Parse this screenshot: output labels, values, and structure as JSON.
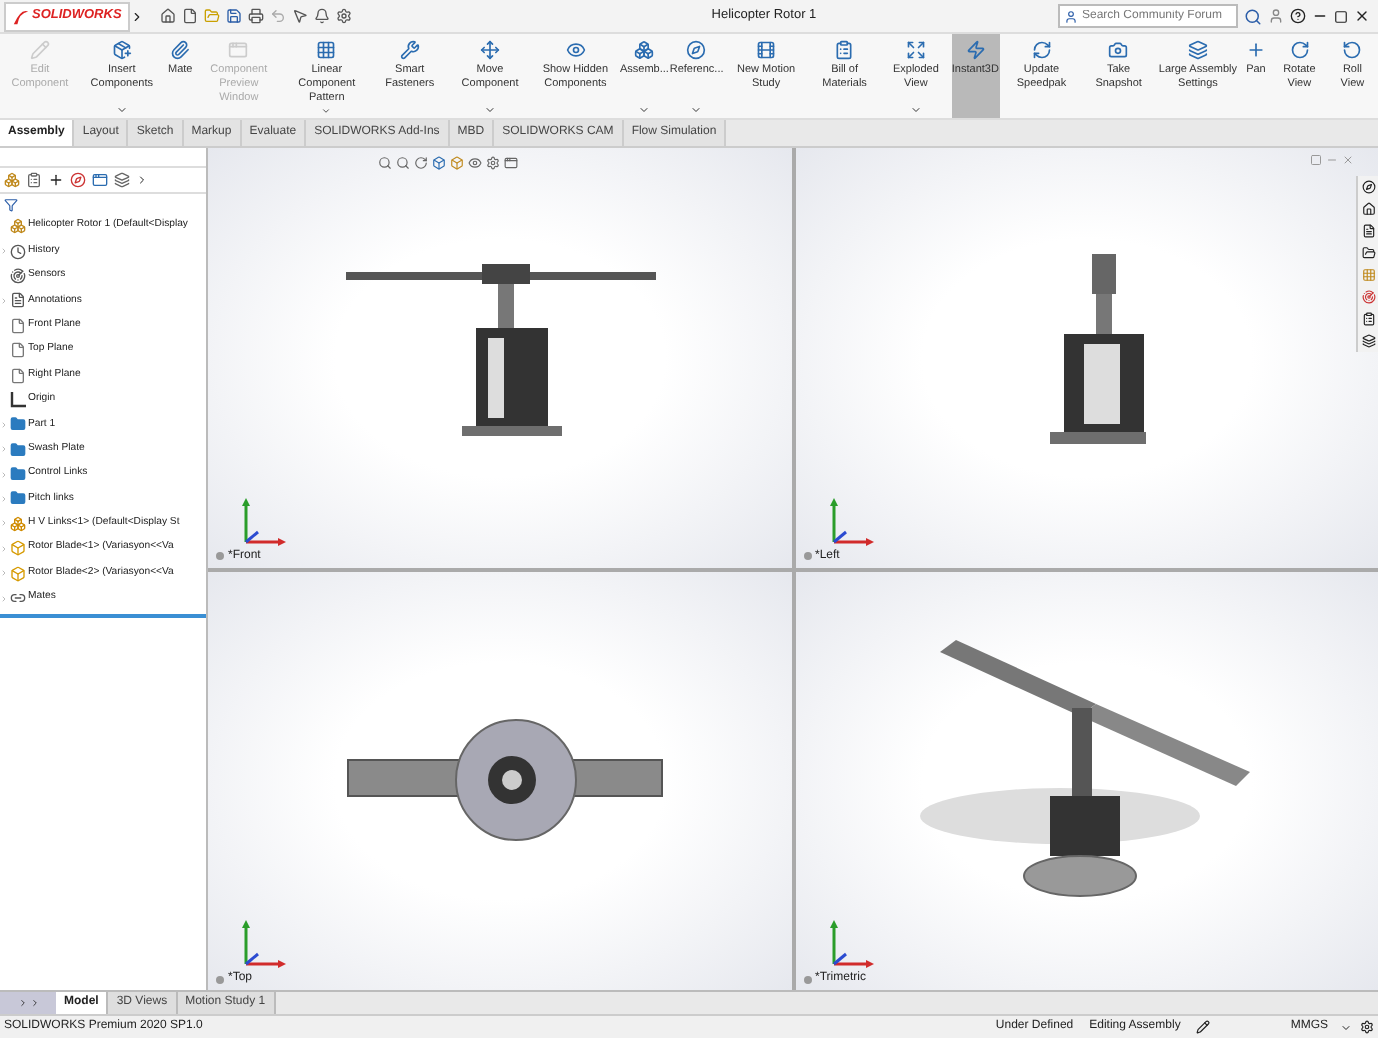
{
  "title_bar": {
    "brand": "SOLIDWORKS",
    "title": "Helicopter Rotor 1",
    "search": {
      "placeholder": "Search Community Forum"
    }
  },
  "ribbon": [
    {
      "label": "Edit Component",
      "disabled": true,
      "selected": false,
      "caret": false
    },
    {
      "label": "Insert Components",
      "disabled": false,
      "selected": false,
      "caret": true
    },
    {
      "label": "Mate",
      "disabled": false,
      "selected": false,
      "caret": false
    },
    {
      "label": "Component Preview Window",
      "disabled": true,
      "selected": false,
      "caret": false
    },
    {
      "label": "Linear Component Pattern",
      "disabled": false,
      "selected": false,
      "caret": true
    },
    {
      "label": "Smart Fasteners",
      "disabled": false,
      "selected": false,
      "caret": false
    },
    {
      "label": "Move Component",
      "disabled": false,
      "selected": false,
      "caret": true
    },
    {
      "label": "Show Hidden Components",
      "disabled": false,
      "selected": false,
      "caret": false
    },
    {
      "label": "Assemb...",
      "disabled": false,
      "selected": false,
      "caret": true
    },
    {
      "label": "Referenc...",
      "disabled": false,
      "selected": false,
      "caret": true
    },
    {
      "label": "New Motion Study",
      "disabled": false,
      "selected": false,
      "caret": false
    },
    {
      "label": "Bill of Materials",
      "disabled": false,
      "selected": false,
      "caret": false
    },
    {
      "label": "Exploded View",
      "disabled": false,
      "selected": false,
      "caret": true
    },
    {
      "label": "Instant3D",
      "disabled": false,
      "selected": true,
      "caret": false
    },
    {
      "label": "Update Speedpak",
      "disabled": false,
      "selected": false,
      "caret": false
    },
    {
      "label": "Take Snapshot",
      "disabled": false,
      "selected": false,
      "caret": false
    },
    {
      "label": "Large Assembly Settings",
      "disabled": false,
      "selected": false,
      "caret": false
    },
    {
      "label": "Pan",
      "disabled": false,
      "selected": false,
      "caret": false
    },
    {
      "label": "Rotate View",
      "disabled": false,
      "selected": false,
      "caret": false
    },
    {
      "label": "Roll View",
      "disabled": false,
      "selected": false,
      "caret": false
    }
  ],
  "tabs": [
    {
      "label": "Assembly",
      "selected": true
    },
    {
      "label": "Layout",
      "selected": false
    },
    {
      "label": "Sketch",
      "selected": false
    },
    {
      "label": "Markup",
      "selected": false
    },
    {
      "label": "Evaluate",
      "selected": false
    },
    {
      "label": "SOLIDWORKS Add-Ins",
      "selected": false
    },
    {
      "label": "MBD",
      "selected": false
    },
    {
      "label": "SOLIDWORKS CAM",
      "selected": false
    },
    {
      "label": "Flow Simulation",
      "selected": false
    }
  ],
  "feature_tree": [
    {
      "label": "Helicopter Rotor 1 (Default<Display",
      "kind": "assembly",
      "expandable": false
    },
    {
      "label": "History",
      "kind": "history",
      "expandable": true
    },
    {
      "label": "Sensors",
      "kind": "sensor",
      "expandable": false
    },
    {
      "label": "Annotations",
      "kind": "annotation",
      "expandable": true
    },
    {
      "label": "Front Plane",
      "kind": "plane",
      "expandable": false
    },
    {
      "label": "Top Plane",
      "kind": "plane",
      "expandable": false
    },
    {
      "label": "Right Plane",
      "kind": "plane",
      "expandable": false
    },
    {
      "label": "Origin",
      "kind": "origin",
      "expandable": false
    },
    {
      "label": "Part 1",
      "kind": "folder",
      "expandable": true
    },
    {
      "label": "Swash Plate",
      "kind": "folder",
      "expandable": true
    },
    {
      "label": "Control Links",
      "kind": "folder",
      "expandable": true
    },
    {
      "label": "Pitch links",
      "kind": "folder",
      "expandable": true
    },
    {
      "label": "H V Links<1> (Default<Display St",
      "kind": "subassembly",
      "expandable": true
    },
    {
      "label": "Rotor Blade<1> (Variasyon<<Va",
      "kind": "part",
      "expandable": true
    },
    {
      "label": "Rotor Blade<2> (Variasyon<<Va",
      "kind": "part",
      "expandable": true
    },
    {
      "label": "Mates",
      "kind": "mates",
      "expandable": true
    }
  ],
  "viewports": [
    {
      "label": "*Front",
      "kind": "front"
    },
    {
      "label": "*Left",
      "kind": "left"
    },
    {
      "label": "*Top",
      "kind": "top"
    },
    {
      "label": "*Trimetric",
      "kind": "trimetric"
    }
  ],
  "bottom_tabs": [
    {
      "label": "Model",
      "selected": true
    },
    {
      "label": "3D Views",
      "selected": false
    },
    {
      "label": "Motion Study 1",
      "selected": false
    }
  ],
  "status_bar": {
    "product": "SOLIDWORKS Premium 2020 SP1.0",
    "state": "Under Defined",
    "mode": "Editing Assembly",
    "units": "MMGS"
  }
}
